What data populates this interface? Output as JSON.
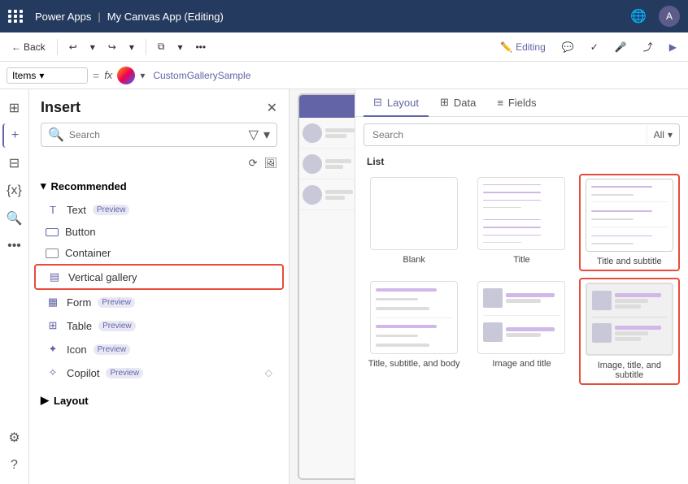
{
  "topbar": {
    "app_name": "Power Apps",
    "separator": "|",
    "file_name": "My Canvas App (Editing)"
  },
  "toolbar": {
    "back_label": "Back",
    "editing_label": "Editing"
  },
  "formula_bar": {
    "dropdown_label": "Items",
    "equals": "=",
    "fx": "fx",
    "value": "CustomGallerySample"
  },
  "insert_panel": {
    "title": "Insert",
    "search_placeholder": "Search",
    "sections": {
      "recommended": "Recommended",
      "layout": "Layout"
    },
    "items": [
      {
        "id": "text",
        "label": "Text",
        "badge": "Preview",
        "icon": "T"
      },
      {
        "id": "button",
        "label": "Button",
        "badge": "",
        "icon": "⬜"
      },
      {
        "id": "container",
        "label": "Container",
        "badge": "",
        "icon": "▭"
      },
      {
        "id": "vertical-gallery",
        "label": "Vertical gallery",
        "badge": "",
        "icon": "▤",
        "highlighted": true
      },
      {
        "id": "form",
        "label": "Form",
        "badge": "Preview",
        "icon": "▦"
      },
      {
        "id": "table",
        "label": "Table",
        "badge": "Preview",
        "icon": "⊞"
      },
      {
        "id": "icon",
        "label": "Icon",
        "badge": "Preview",
        "icon": "✦"
      },
      {
        "id": "copilot",
        "label": "Copilot",
        "badge": "Preview",
        "icon": "✧"
      }
    ]
  },
  "layout_panel": {
    "tabs": [
      {
        "id": "layout",
        "label": "Layout",
        "active": true
      },
      {
        "id": "data",
        "label": "Data",
        "active": false
      },
      {
        "id": "fields",
        "label": "Fields",
        "active": false
      }
    ],
    "search_placeholder": "Search",
    "search_filter": "All",
    "section_title": "List",
    "layouts": [
      {
        "id": "blank",
        "label": "Blank",
        "type": "blank"
      },
      {
        "id": "title",
        "label": "Title",
        "type": "title"
      },
      {
        "id": "title-subtitle",
        "label": "Title and subtitle",
        "type": "title-subtitle",
        "highlighted": true
      },
      {
        "id": "title-subtitle-body",
        "label": "Title, subtitle, and body",
        "type": "title-subtitle-body"
      },
      {
        "id": "image-title",
        "label": "Image and title",
        "type": "image-title"
      },
      {
        "id": "image-title-subtitle",
        "label": "Image, title, and subtitle",
        "type": "image-title-subtitle",
        "selected": true
      }
    ]
  }
}
